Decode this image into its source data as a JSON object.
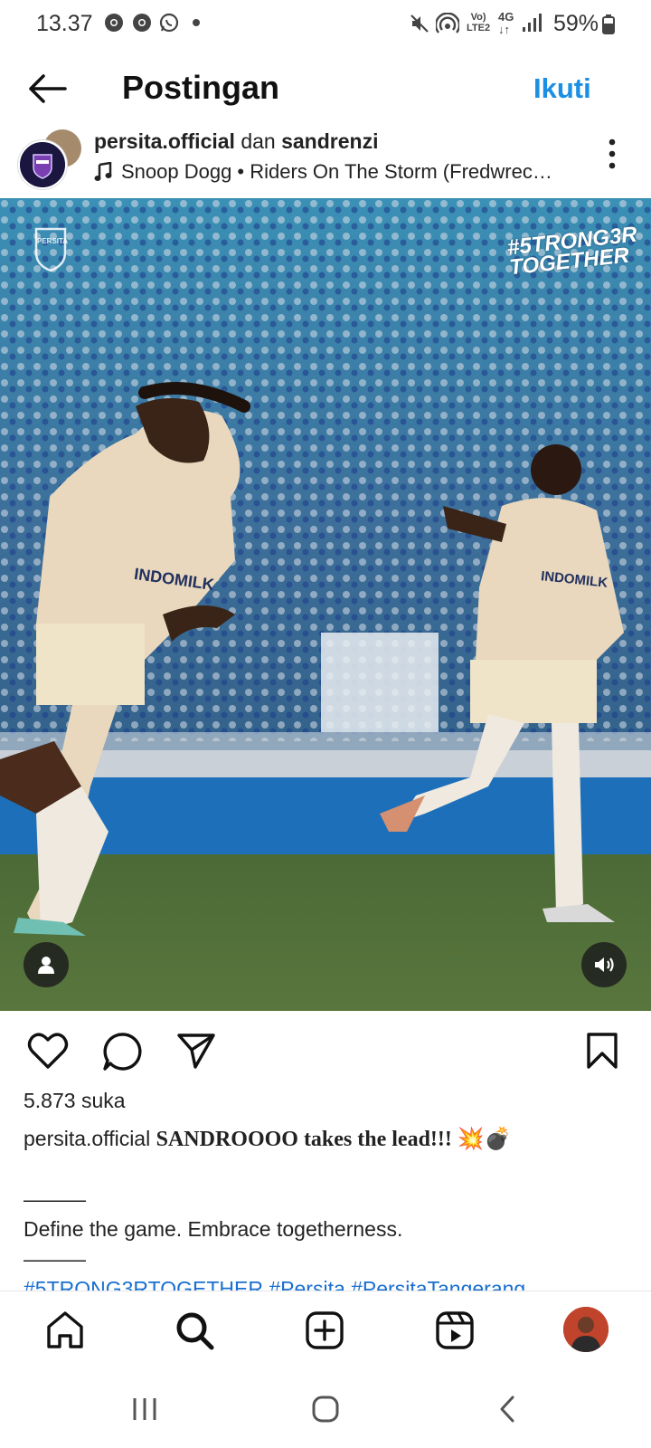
{
  "status_bar": {
    "time": "13.37",
    "network_label_top": "Vo)",
    "network_label_bottom": "LTE2",
    "network_type": "4G",
    "battery": "59%",
    "icons": [
      "chrome-icon",
      "chrome-icon",
      "whatsapp-icon",
      "dot-icon",
      "mute-icon",
      "hotspot-icon",
      "signal-icon",
      "battery-icon"
    ]
  },
  "header": {
    "title": "Postingan",
    "follow_label": "Ikuti",
    "follow_color": "#1a8fe3"
  },
  "post": {
    "author_primary": "persita.official",
    "author_join": "dan",
    "author_secondary": "sandrenzi",
    "audio": "Snoop Dogg • Riders On The Storm (Fredwrec…",
    "media_overlay_text_1": "#5TRONG3R",
    "media_overlay_text_2": "TOGETHER",
    "crest_label": "PERSITA",
    "shirt_sponsor": "INDOMILK",
    "likes": "5.873 suka",
    "caption_user": "persita.official",
    "caption_text": "SANDROOOO takes the lead!!! 💥💣",
    "separator": "———",
    "tagline": "Define the game. Embrace togetherness.",
    "hashtags": "#5TRONG3RTOGETHER #Persita #PersitaTangerang"
  },
  "accent_colors": {
    "link": "#1a8fe3",
    "hashtag": "#1a6fcf"
  }
}
